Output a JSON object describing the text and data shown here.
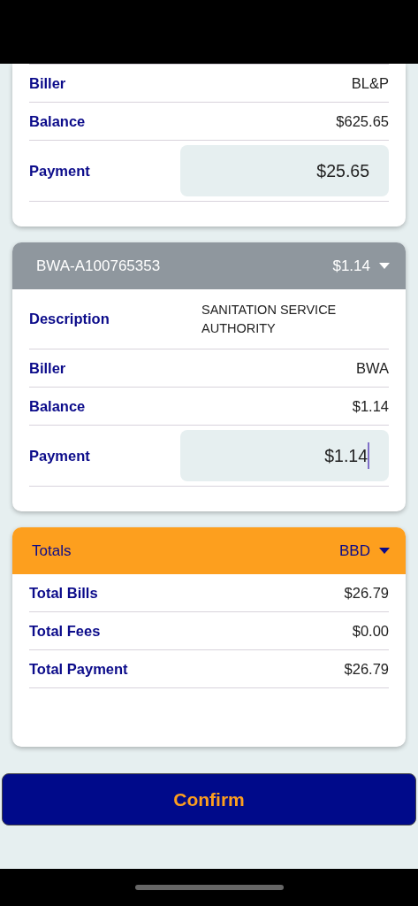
{
  "bills": [
    {
      "rows": [
        {
          "label": "Biller",
          "value": "BL&P"
        },
        {
          "label": "Balance",
          "value": "$625.65"
        }
      ],
      "payment": {
        "label": "Payment",
        "value": "$25.65",
        "focused": false
      }
    },
    {
      "header": {
        "account": "BWA-A100765353",
        "amount": "$1.14"
      },
      "rows": [
        {
          "label": "Description",
          "value": "SANITATION SERVICE AUTHORITY",
          "kind": "small"
        },
        {
          "label": "Biller",
          "value": "BWA"
        },
        {
          "label": "Balance",
          "value": "$1.14"
        }
      ],
      "payment": {
        "label": "Payment",
        "value": "$1.14",
        "focused": true
      }
    }
  ],
  "totals": {
    "title": "Totals",
    "currency": "BBD",
    "rows": [
      {
        "label": "Total Bills",
        "value": "$26.79"
      },
      {
        "label": "Total Fees",
        "value": "$0.00"
      },
      {
        "label": "Total Payment",
        "value": "$26.79"
      }
    ]
  },
  "confirm_button": "Confirm"
}
